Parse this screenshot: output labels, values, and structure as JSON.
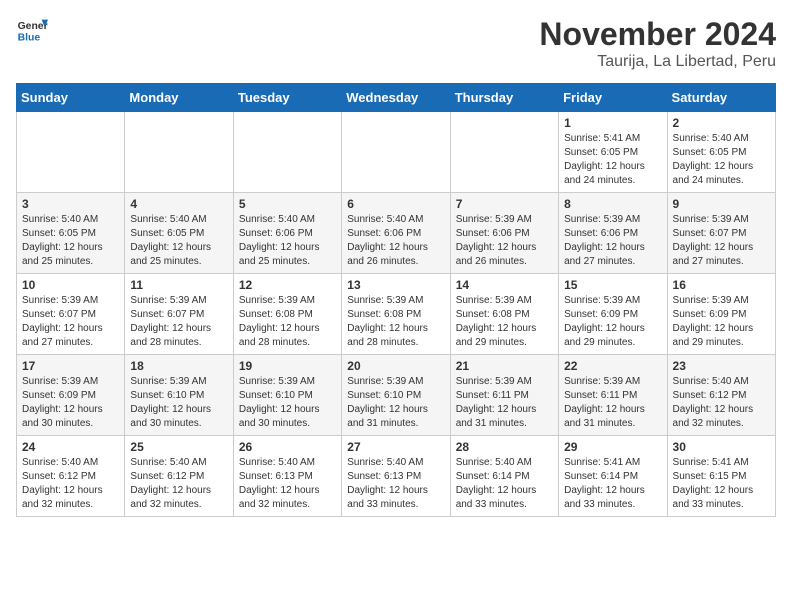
{
  "header": {
    "logo_general": "General",
    "logo_blue": "Blue",
    "title": "November 2024",
    "subtitle": "Taurija, La Libertad, Peru"
  },
  "calendar": {
    "days_of_week": [
      "Sunday",
      "Monday",
      "Tuesday",
      "Wednesday",
      "Thursday",
      "Friday",
      "Saturday"
    ],
    "weeks": [
      [
        {
          "day": "",
          "info": ""
        },
        {
          "day": "",
          "info": ""
        },
        {
          "day": "",
          "info": ""
        },
        {
          "day": "",
          "info": ""
        },
        {
          "day": "",
          "info": ""
        },
        {
          "day": "1",
          "info": "Sunrise: 5:41 AM\nSunset: 6:05 PM\nDaylight: 12 hours and 24 minutes."
        },
        {
          "day": "2",
          "info": "Sunrise: 5:40 AM\nSunset: 6:05 PM\nDaylight: 12 hours and 24 minutes."
        }
      ],
      [
        {
          "day": "3",
          "info": "Sunrise: 5:40 AM\nSunset: 6:05 PM\nDaylight: 12 hours and 25 minutes."
        },
        {
          "day": "4",
          "info": "Sunrise: 5:40 AM\nSunset: 6:05 PM\nDaylight: 12 hours and 25 minutes."
        },
        {
          "day": "5",
          "info": "Sunrise: 5:40 AM\nSunset: 6:06 PM\nDaylight: 12 hours and 25 minutes."
        },
        {
          "day": "6",
          "info": "Sunrise: 5:40 AM\nSunset: 6:06 PM\nDaylight: 12 hours and 26 minutes."
        },
        {
          "day": "7",
          "info": "Sunrise: 5:39 AM\nSunset: 6:06 PM\nDaylight: 12 hours and 26 minutes."
        },
        {
          "day": "8",
          "info": "Sunrise: 5:39 AM\nSunset: 6:06 PM\nDaylight: 12 hours and 27 minutes."
        },
        {
          "day": "9",
          "info": "Sunrise: 5:39 AM\nSunset: 6:07 PM\nDaylight: 12 hours and 27 minutes."
        }
      ],
      [
        {
          "day": "10",
          "info": "Sunrise: 5:39 AM\nSunset: 6:07 PM\nDaylight: 12 hours and 27 minutes."
        },
        {
          "day": "11",
          "info": "Sunrise: 5:39 AM\nSunset: 6:07 PM\nDaylight: 12 hours and 28 minutes."
        },
        {
          "day": "12",
          "info": "Sunrise: 5:39 AM\nSunset: 6:08 PM\nDaylight: 12 hours and 28 minutes."
        },
        {
          "day": "13",
          "info": "Sunrise: 5:39 AM\nSunset: 6:08 PM\nDaylight: 12 hours and 28 minutes."
        },
        {
          "day": "14",
          "info": "Sunrise: 5:39 AM\nSunset: 6:08 PM\nDaylight: 12 hours and 29 minutes."
        },
        {
          "day": "15",
          "info": "Sunrise: 5:39 AM\nSunset: 6:09 PM\nDaylight: 12 hours and 29 minutes."
        },
        {
          "day": "16",
          "info": "Sunrise: 5:39 AM\nSunset: 6:09 PM\nDaylight: 12 hours and 29 minutes."
        }
      ],
      [
        {
          "day": "17",
          "info": "Sunrise: 5:39 AM\nSunset: 6:09 PM\nDaylight: 12 hours and 30 minutes."
        },
        {
          "day": "18",
          "info": "Sunrise: 5:39 AM\nSunset: 6:10 PM\nDaylight: 12 hours and 30 minutes."
        },
        {
          "day": "19",
          "info": "Sunrise: 5:39 AM\nSunset: 6:10 PM\nDaylight: 12 hours and 30 minutes."
        },
        {
          "day": "20",
          "info": "Sunrise: 5:39 AM\nSunset: 6:10 PM\nDaylight: 12 hours and 31 minutes."
        },
        {
          "day": "21",
          "info": "Sunrise: 5:39 AM\nSunset: 6:11 PM\nDaylight: 12 hours and 31 minutes."
        },
        {
          "day": "22",
          "info": "Sunrise: 5:39 AM\nSunset: 6:11 PM\nDaylight: 12 hours and 31 minutes."
        },
        {
          "day": "23",
          "info": "Sunrise: 5:40 AM\nSunset: 6:12 PM\nDaylight: 12 hours and 32 minutes."
        }
      ],
      [
        {
          "day": "24",
          "info": "Sunrise: 5:40 AM\nSunset: 6:12 PM\nDaylight: 12 hours and 32 minutes."
        },
        {
          "day": "25",
          "info": "Sunrise: 5:40 AM\nSunset: 6:12 PM\nDaylight: 12 hours and 32 minutes."
        },
        {
          "day": "26",
          "info": "Sunrise: 5:40 AM\nSunset: 6:13 PM\nDaylight: 12 hours and 32 minutes."
        },
        {
          "day": "27",
          "info": "Sunrise: 5:40 AM\nSunset: 6:13 PM\nDaylight: 12 hours and 33 minutes."
        },
        {
          "day": "28",
          "info": "Sunrise: 5:40 AM\nSunset: 6:14 PM\nDaylight: 12 hours and 33 minutes."
        },
        {
          "day": "29",
          "info": "Sunrise: 5:41 AM\nSunset: 6:14 PM\nDaylight: 12 hours and 33 minutes."
        },
        {
          "day": "30",
          "info": "Sunrise: 5:41 AM\nSunset: 6:15 PM\nDaylight: 12 hours and 33 minutes."
        }
      ]
    ]
  }
}
